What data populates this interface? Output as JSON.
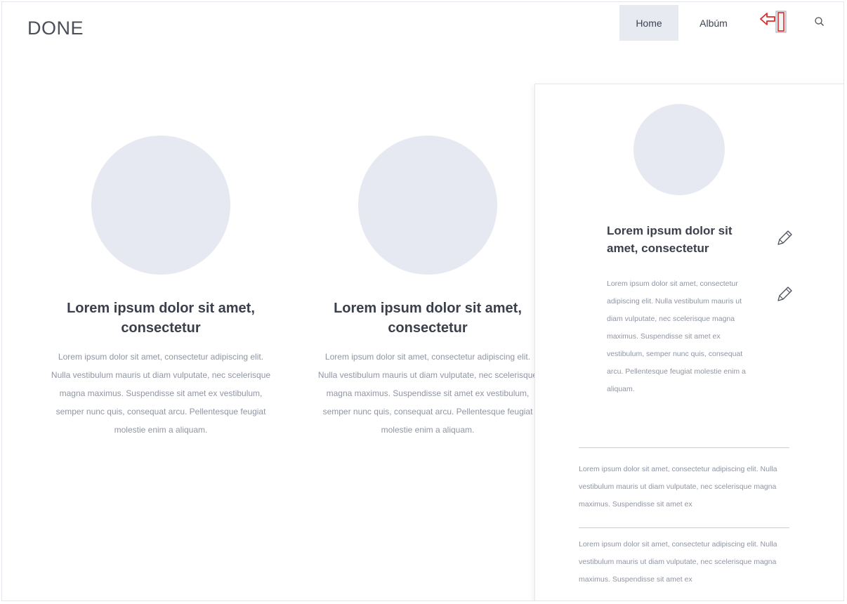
{
  "header": {
    "logo": "DONE",
    "nav": {
      "home_label": "Home",
      "album_label": "Albúm"
    },
    "icons": {
      "logout": "logout-icon",
      "search": "search-icon"
    },
    "colors": {
      "active_nav_bg": "#e7eaf1",
      "logout_accent": "#e02a2a"
    }
  },
  "cards": [
    {
      "title": "Lorem ipsum dolor sit amet, consectetur",
      "text": "Lorem ipsum dolor sit amet, consectetur adipiscing elit. Nulla vestibulum mauris ut diam vulputate, nec scelerisque magna maximus. Suspendisse sit amet ex vestibulum, semper nunc quis, consequat arcu. Pellentesque feugiat molestie enim a aliquam."
    },
    {
      "title": "Lorem ipsum dolor sit amet, consectetur",
      "text": "Lorem ipsum dolor sit amet, consectetur adipiscing elit. Nulla vestibulum mauris ut diam vulputate, nec scelerisque magna maximus. Suspendisse sit amet ex vestibulum, semper nunc quis, consequat arcu. Pellentesque feugiat molestie enim a aliquam."
    }
  ],
  "panel": {
    "title": "Lorem ipsum dolor sit amet, consectetur",
    "description": "Lorem ipsum dolor sit amet, consectetur adipiscing elit. Nulla vestibulum mauris ut diam vulputate, nec scelerisque magna maximus. Suspendisse sit amet ex vestibulum, semper nunc quis, consequat arcu. Pellentesque feugiat molestie enim a aliquam.",
    "edit_icon": "pencil-icon",
    "paragraphs": [
      "Lorem ipsum dolor sit amet, consectetur adipiscing elit. Nulla vestibulum mauris ut diam vulputate, nec scelerisque magna maximus. Suspendisse sit amet ex",
      "Lorem ipsum dolor sit amet, consectetur adipiscing elit. Nulla vestibulum mauris ut diam vulputate, nec scelerisque magna maximus. Suspendisse sit amet ex"
    ]
  }
}
